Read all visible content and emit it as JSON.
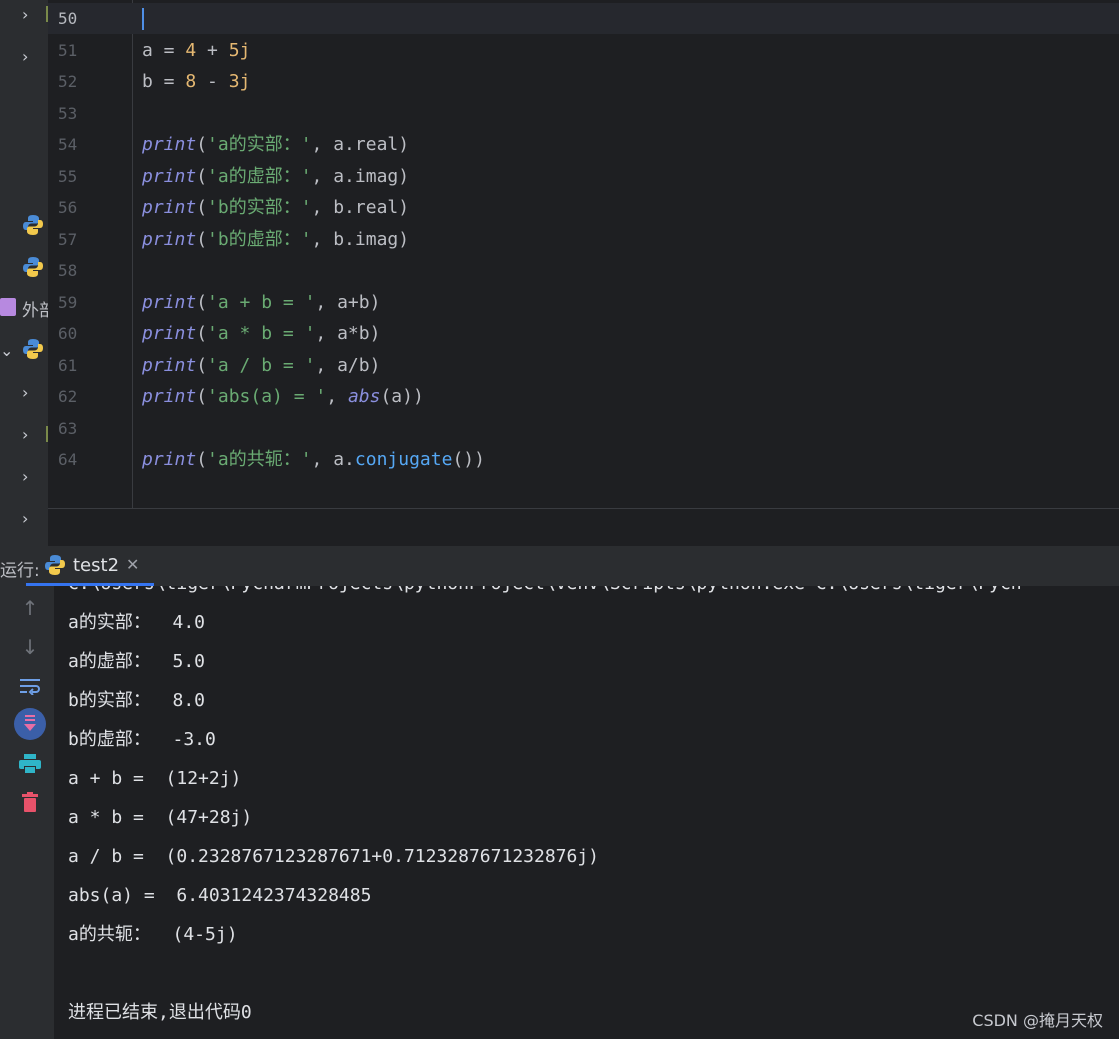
{
  "tree": {
    "external_label": "外部"
  },
  "editor": {
    "lines": [
      {
        "n": "50",
        "tokens": []
      },
      {
        "n": "51",
        "tokens": [
          {
            "t": "a",
            "c": "id"
          },
          {
            "t": " = ",
            "c": "op"
          },
          {
            "t": "4",
            "c": "num"
          },
          {
            "t": " + ",
            "c": "op"
          },
          {
            "t": "5j",
            "c": "num"
          }
        ]
      },
      {
        "n": "52",
        "tokens": [
          {
            "t": "b",
            "c": "id"
          },
          {
            "t": " = ",
            "c": "op"
          },
          {
            "t": "8",
            "c": "num"
          },
          {
            "t": " - ",
            "c": "op"
          },
          {
            "t": "3j",
            "c": "num"
          }
        ]
      },
      {
        "n": "53",
        "tokens": []
      },
      {
        "n": "54",
        "tokens": [
          {
            "t": "print",
            "c": "fn"
          },
          {
            "t": "(",
            "c": "op"
          },
          {
            "t": "'a的实部：'",
            "c": "str"
          },
          {
            "t": ", a.real)",
            "c": "id"
          }
        ]
      },
      {
        "n": "55",
        "tokens": [
          {
            "t": "print",
            "c": "fn"
          },
          {
            "t": "(",
            "c": "op"
          },
          {
            "t": "'a的虚部：'",
            "c": "str"
          },
          {
            "t": ", a.imag)",
            "c": "id"
          }
        ]
      },
      {
        "n": "56",
        "tokens": [
          {
            "t": "print",
            "c": "fn"
          },
          {
            "t": "(",
            "c": "op"
          },
          {
            "t": "'b的实部：'",
            "c": "str"
          },
          {
            "t": ", b.real)",
            "c": "id"
          }
        ]
      },
      {
        "n": "57",
        "tokens": [
          {
            "t": "print",
            "c": "fn"
          },
          {
            "t": "(",
            "c": "op"
          },
          {
            "t": "'b的虚部：'",
            "c": "str"
          },
          {
            "t": ", b.imag)",
            "c": "id"
          }
        ]
      },
      {
        "n": "58",
        "tokens": []
      },
      {
        "n": "59",
        "tokens": [
          {
            "t": "print",
            "c": "fn"
          },
          {
            "t": "(",
            "c": "op"
          },
          {
            "t": "'a + b = '",
            "c": "str"
          },
          {
            "t": ", a+b)",
            "c": "id"
          }
        ]
      },
      {
        "n": "60",
        "tokens": [
          {
            "t": "print",
            "c": "fn"
          },
          {
            "t": "(",
            "c": "op"
          },
          {
            "t": "'a * b = '",
            "c": "str"
          },
          {
            "t": ", a*b)",
            "c": "id"
          }
        ]
      },
      {
        "n": "61",
        "tokens": [
          {
            "t": "print",
            "c": "fn"
          },
          {
            "t": "(",
            "c": "op"
          },
          {
            "t": "'a / b = '",
            "c": "str"
          },
          {
            "t": ", a/b)",
            "c": "id"
          }
        ]
      },
      {
        "n": "62",
        "tokens": [
          {
            "t": "print",
            "c": "fn"
          },
          {
            "t": "(",
            "c": "op"
          },
          {
            "t": "'abs(a) = '",
            "c": "str"
          },
          {
            "t": ", ",
            "c": "id"
          },
          {
            "t": "abs",
            "c": "fn"
          },
          {
            "t": "(a))",
            "c": "id"
          }
        ]
      },
      {
        "n": "63",
        "tokens": []
      },
      {
        "n": "64",
        "tokens": [
          {
            "t": "print",
            "c": "fn"
          },
          {
            "t": "(",
            "c": "op"
          },
          {
            "t": "'a的共轭：'",
            "c": "str"
          },
          {
            "t": ", a.",
            "c": "id"
          },
          {
            "t": "conjugate",
            "c": "meth"
          },
          {
            "t": "())",
            "c": "id"
          }
        ]
      }
    ]
  },
  "run": {
    "label": "运行:",
    "tab_label": "test2",
    "command_line": "C:\\Users\\tiger\\PycharmProjects\\pythonProject\\venv\\Scripts\\python.exe C:\\Users\\tiger\\Pych",
    "output": [
      "a的实部：  4.0",
      "a的虚部：  5.0",
      "b的实部：  8.0",
      "b的虚部：  -3.0",
      "a + b =  (12+2j)",
      "a * b =  (47+28j)",
      "a / b =  (0.2328767123287671+0.7123287671232876j)",
      "abs(a) =  6.4031242374328485",
      "a的共轭：  (4-5j)",
      "",
      "进程已结束,退出代码0"
    ]
  },
  "watermark": "CSDN @掩月天权",
  "colors": {
    "accent": "#3574f0",
    "string": "#6aab73",
    "number": "#e5b872",
    "builtin": "#8a8fde"
  }
}
